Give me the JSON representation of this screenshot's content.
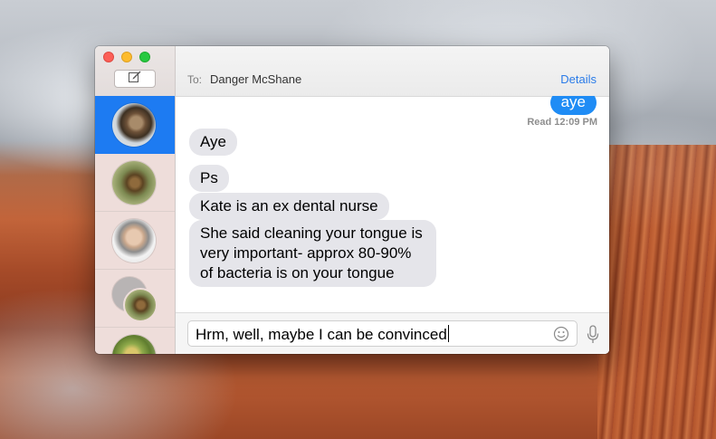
{
  "window": {
    "buttons": {
      "close": "close",
      "minimize": "minimize",
      "zoom": "zoom"
    },
    "compose_icon": "compose-icon"
  },
  "header": {
    "to_label": "To:",
    "recipient": "Danger McShane",
    "details_label": "Details"
  },
  "sidebar": {
    "conversations": [
      {
        "avatar": "horse-avatar",
        "active": true
      },
      {
        "avatar": "animal-avatar",
        "active": false
      },
      {
        "avatar": "man-avatar",
        "active": false
      },
      {
        "avatar": "group-avatar",
        "active": false
      },
      {
        "avatar": "green-avatar",
        "active": false
      }
    ]
  },
  "messages": {
    "outgoing_last": "aye",
    "read_receipt_label": "Read",
    "read_receipt_time": "12:09 PM",
    "incoming": [
      "Aye",
      "Ps",
      "Kate is an ex dental nurse",
      "She said cleaning your tongue is very important- approx 80-90% of bacteria is on your tongue"
    ]
  },
  "composer": {
    "value": "Hrm, well, maybe I can be convinced",
    "emoji_icon": "smiley-icon",
    "mic_icon": "microphone-icon"
  },
  "colors": {
    "accent": "#1d7bf2",
    "outgoing_bubble": "#1f8cf5",
    "incoming_bubble": "#e5e5ea",
    "link": "#2a7be8"
  }
}
